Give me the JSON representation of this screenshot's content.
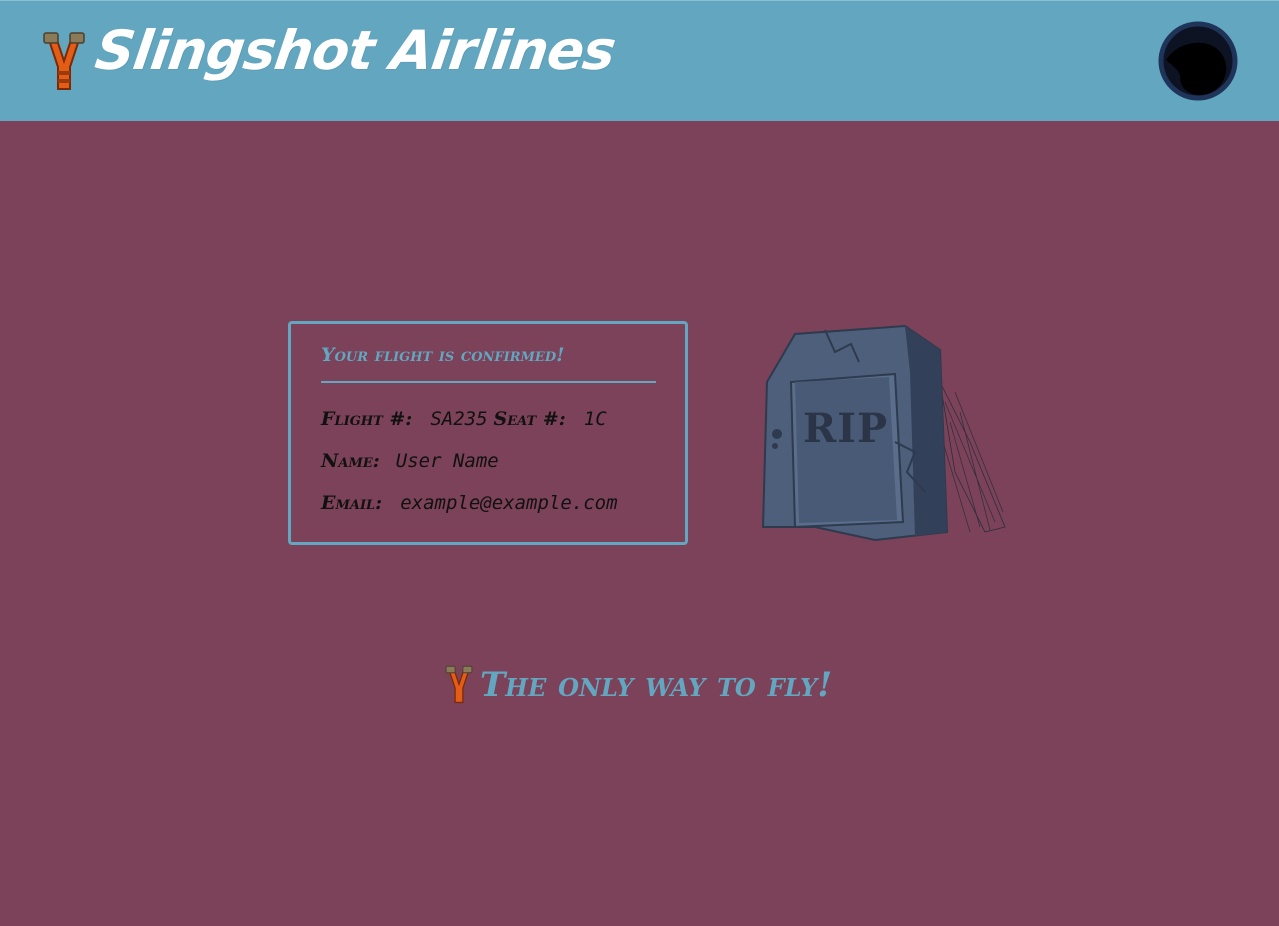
{
  "header": {
    "title": "Slingshot Airlines",
    "logo_icon": "slingshot-icon",
    "avatar_icon": "bird-silhouette-icon"
  },
  "confirmation": {
    "title": "Your flight is confirmed!",
    "flight_label": "Flight #:",
    "flight_value": "SA235",
    "seat_label": "Seat #:",
    "seat_value": "1C",
    "name_label": "Name:",
    "name_value": "User Name",
    "email_label": "Email:",
    "email_value": "example@example.com"
  },
  "illustration": {
    "icon": "tombstone-icon",
    "engraving": "RIP"
  },
  "footer": {
    "tagline": "The only way to fly!",
    "tag_icon": "slingshot-icon"
  },
  "colors": {
    "background": "#7b4259",
    "header": "#63a6c0",
    "accent": "#63a6c0",
    "text_dark": "#111111",
    "title_text": "#ffffff"
  }
}
